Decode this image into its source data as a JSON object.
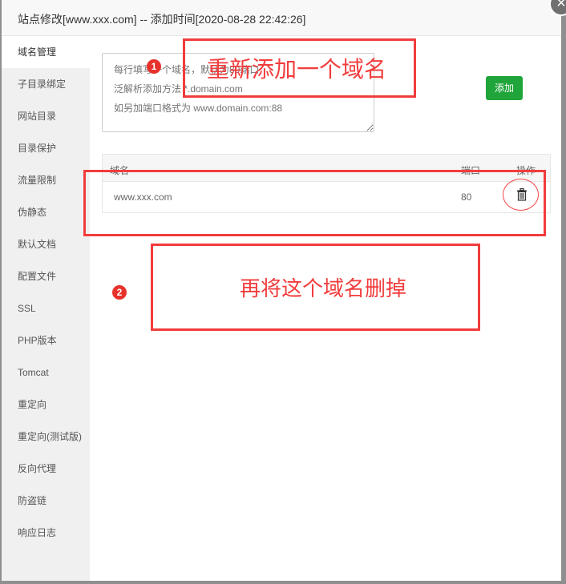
{
  "window": {
    "title": "站点修改[www.xxx.com] -- 添加时间[2020-08-28 22:42:26]",
    "close_icon": "×"
  },
  "sidebar": {
    "items": [
      {
        "label": "域名管理",
        "active": true
      },
      {
        "label": "子目录绑定"
      },
      {
        "label": "网站目录"
      },
      {
        "label": "目录保护"
      },
      {
        "label": "流量限制"
      },
      {
        "label": "伪静态"
      },
      {
        "label": "默认文档"
      },
      {
        "label": "配置文件"
      },
      {
        "label": "SSL"
      },
      {
        "label": "PHP版本"
      },
      {
        "label": "Tomcat"
      },
      {
        "label": "重定向"
      },
      {
        "label": "重定向(测试版)"
      },
      {
        "label": "反向代理"
      },
      {
        "label": "防盗链"
      },
      {
        "label": "响应日志"
      }
    ]
  },
  "domain_form": {
    "placeholder": "每行填写一个域名，默认为80端口\n泛解析添加方法 *.domain.com\n如另加端口格式为 www.domain.com:88",
    "value": "",
    "add_button": "添加"
  },
  "domain_table": {
    "headers": {
      "domain": "域名",
      "port": "端口",
      "action": "操作"
    },
    "rows": [
      {
        "domain": "www.xxx.com",
        "port": "80",
        "action_icon": "trash-icon"
      }
    ]
  },
  "annotations": {
    "step1_badge": "1",
    "step1_text": "重新添加一个域名",
    "step2_badge": "2",
    "step2_text": "再将这个域名删掉",
    "color": "#f23c3c"
  }
}
